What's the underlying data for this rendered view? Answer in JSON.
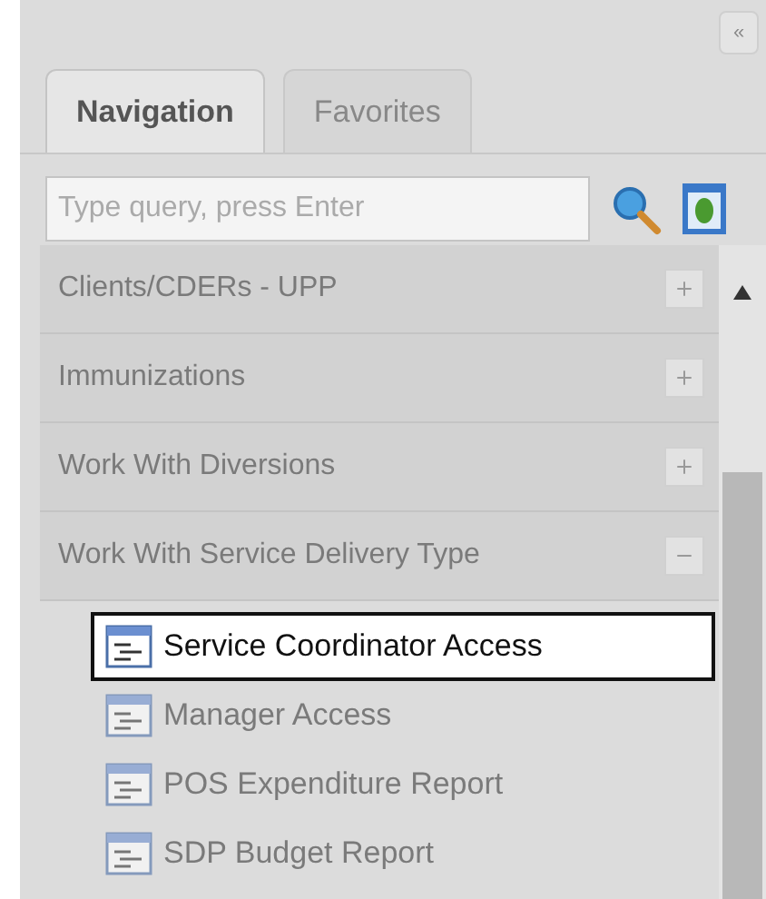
{
  "collapse_button": "«",
  "tabs": [
    {
      "label": "Navigation",
      "selected": true
    },
    {
      "label": "Favorites",
      "selected": false
    }
  ],
  "search": {
    "placeholder": "Type query, press Enter"
  },
  "sections": [
    {
      "label": "Clients/CDERs - UPP",
      "expanded": false
    },
    {
      "label": "Immunizations",
      "expanded": false
    },
    {
      "label": "Work With Diversions",
      "expanded": false
    },
    {
      "label": "Work With Service Delivery Type",
      "expanded": true,
      "children": [
        {
          "label": "Service Coordinator Access",
          "selected": true
        },
        {
          "label": "Manager Access",
          "selected": false
        },
        {
          "label": "POS Expenditure Report",
          "selected": false
        },
        {
          "label": "SDP Budget Report",
          "selected": false
        }
      ]
    }
  ]
}
